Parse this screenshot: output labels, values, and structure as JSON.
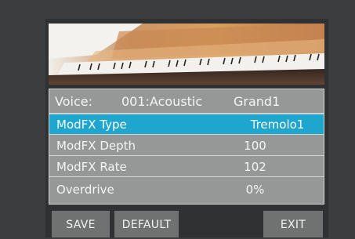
{
  "voice": {
    "label": "Voice:",
    "number": "001:Acoustic",
    "name": "Grand1"
  },
  "params": [
    {
      "label": "ModFX Type",
      "value": "Tremolo1",
      "selected": true
    },
    {
      "label": "ModFX Depth",
      "value": "100",
      "selected": false
    },
    {
      "label": "ModFX Rate",
      "value": "102",
      "selected": false
    },
    {
      "label": "Overdrive",
      "value": "0%",
      "selected": false
    }
  ],
  "buttons": {
    "save": "SAVE",
    "default": "DEFAULT",
    "exit": "EXIT"
  },
  "colors": {
    "highlight": "#1fa6cf",
    "panel": "#969898",
    "background": "#3b3d3e"
  }
}
